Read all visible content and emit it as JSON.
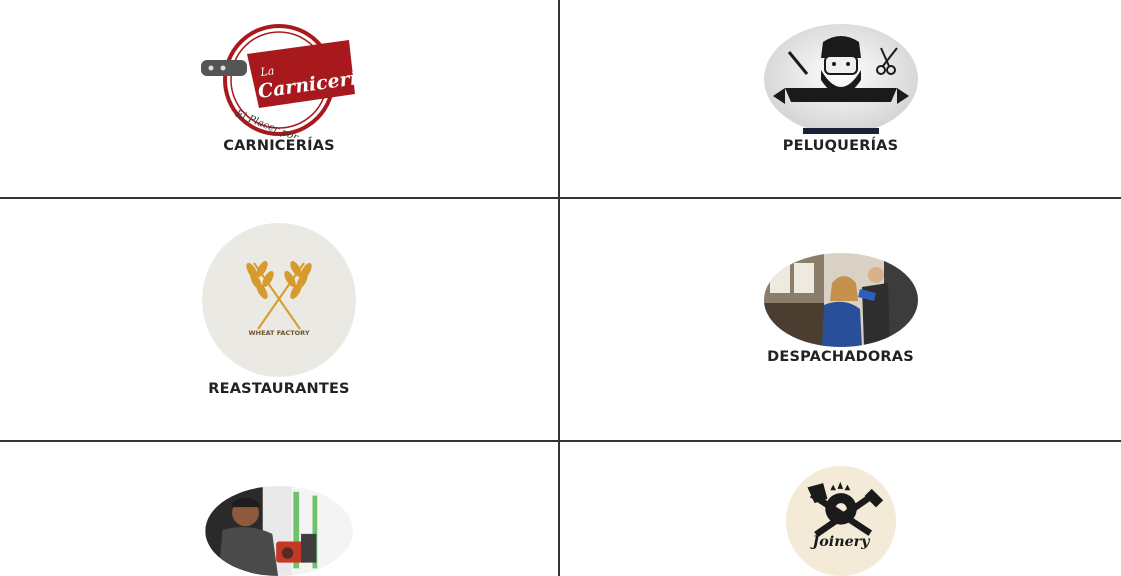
{
  "categories": [
    {
      "label": "CARNICERÍAS",
      "logo_text_1": "La",
      "logo_text_2": "Carnicería",
      "logo_text_3": "El Placer por el Sabor",
      "icon": "butcher-logo-icon"
    },
    {
      "label": "PELUQUERÍAS",
      "icon": "barber-logo-icon"
    },
    {
      "label": "REASTAURANTES",
      "logo_text_1": "WHEAT FACTORY",
      "icon": "wheat-logo-icon"
    },
    {
      "label": "DESPACHADORAS",
      "icon": "salon-photo-icon"
    },
    {
      "label": "",
      "icon": "mechanic-photo-icon"
    },
    {
      "label": "",
      "logo_text_1": "Joinery",
      "icon": "joinery-logo-icon"
    }
  ],
  "colors": {
    "brand_red": "#a8191e",
    "grid_border": "#333333",
    "label_text": "#222222"
  }
}
